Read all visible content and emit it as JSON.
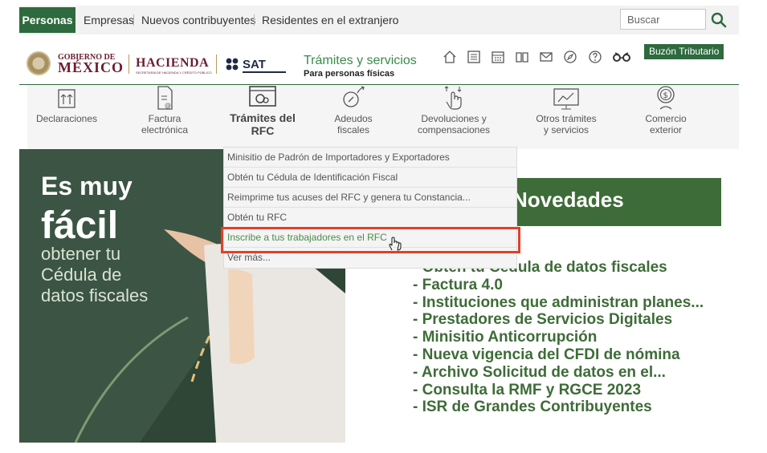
{
  "topbar": {
    "tabs": [
      "Personas",
      "Empresas",
      "Nuevos contribuyentes",
      "Residentes en el extranjero"
    ],
    "search_placeholder": "Buscar"
  },
  "header": {
    "gob_line1": "GOBIERNO DE",
    "gob_line2": "MÉXICO",
    "hacienda": "HACIENDA",
    "hacienda_sub": "SECRETARÍA DE HACIENDA Y CRÉDITO PÚBLICO",
    "sat": "SAT",
    "tramites_title": "Trámites y servicios",
    "tramites_sub": "Para personas físicas",
    "buzon": "Buzón Tributario"
  },
  "categories": [
    {
      "label": "Declaraciones",
      "icon": "declaraciones-icon"
    },
    {
      "label": "Factura\nelectrónica",
      "icon": "factura-icon"
    },
    {
      "label": "Trámites del\nRFC",
      "icon": "rfc-icon"
    },
    {
      "label": "Adeudos\nfiscales",
      "icon": "adeudos-icon"
    },
    {
      "label": "Devoluciones y\ncompensaciones",
      "icon": "devoluciones-icon"
    },
    {
      "label": "Otros trámites\ny servicios",
      "icon": "otros-icon"
    },
    {
      "label": "Comercio\nexterior",
      "icon": "comercio-icon"
    }
  ],
  "dropdown": {
    "items": [
      "Minisitio de Padrón de Importadores y Exportadores",
      "Obtén tu Cédula de Identificación Fiscal",
      "Reimprime tus acuses del RFC y genera tu Constancia...",
      "Obtén tu RFC",
      "Inscribe a tus trabajadores en el RFC",
      "Ver más..."
    ]
  },
  "hero": {
    "line1": "Es muy",
    "line2": "fácil",
    "line3": "obtener tu\nCédula de\ndatos fiscales"
  },
  "novedades": {
    "title": "Novedades",
    "items": [
      "- Obtén tu Cédula de datos fiscales",
      "- Factura 4.0",
      "- Instituciones que administran planes...",
      "- Prestadores de Servicios Digitales",
      "- Minisitio Anticorrupción",
      "- Nueva vigencia del CFDI de nómina",
      "- Archivo Solicitud de datos en el...",
      "- Consulta la RMF y RGCE 2023",
      "- ISR de Grandes Contribuyentes"
    ]
  },
  "colors": {
    "brand_green": "#2d6a3e",
    "news_green": "#3e6c38",
    "highlight_red": "#e0402a",
    "gob_maroon": "#6b1e2f"
  }
}
